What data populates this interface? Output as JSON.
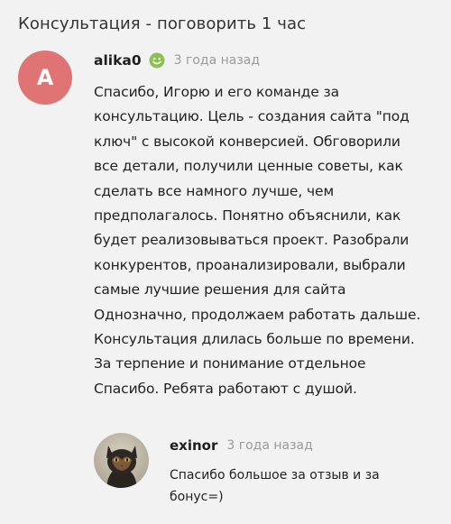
{
  "page": {
    "title": "Консультация - поговорить 1 час"
  },
  "review": {
    "avatar_letter": "A",
    "avatar_color": "#e07373",
    "author": "alika0",
    "badge_icon": "smile-icon",
    "time": "3 года назад",
    "lines": [
      "Спасибо, Игорю и его команде за",
      "консультацию. Цель - создания сайта \"под",
      "ключ\" с высокой конверсией. Обговорили",
      "все детали, получили ценные советы, как",
      "сделать все намного лучше, чем",
      "предполагалось. Понятно объяснили, как",
      "будет реализовываться проект. Разобрали",
      "конкурентов, проанализировали, выбрали",
      "самые лучшие решения для сайта",
      "Однозначно, продолжаем работать дальше.",
      "Консультация длилась больше по времени.",
      "За терпение и понимание отдельное",
      "Спасибо. Ребята работают с душой."
    ]
  },
  "reply": {
    "avatar_icon": "cat-photo-avatar",
    "author": "exinor",
    "time": "3 года назад",
    "lines": [
      "Спасибо большое за отзыв и за",
      "бонус=)"
    ]
  },
  "colors": {
    "background": "#f2f2f2",
    "badge_green": "#8cc152",
    "time_gray": "#9a9a9a"
  }
}
